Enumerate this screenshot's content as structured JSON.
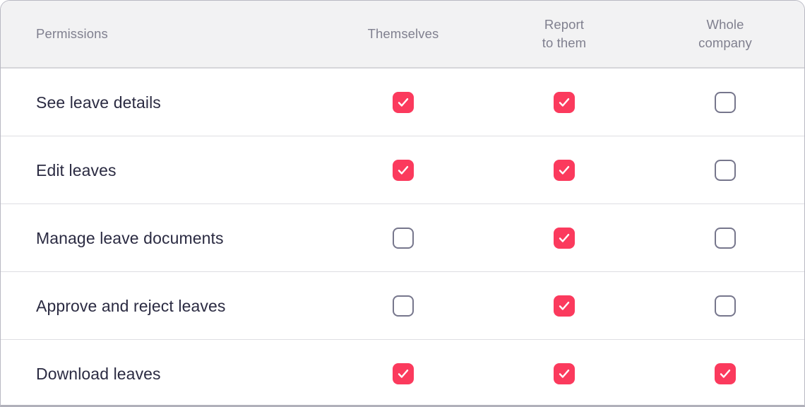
{
  "table": {
    "columns": [
      {
        "key": "permissions",
        "label": "Permissions"
      },
      {
        "key": "themselves",
        "label": "Themselves"
      },
      {
        "key": "report_to_them",
        "label": "Report\nto them"
      },
      {
        "key": "whole_company",
        "label": "Whole\ncompany"
      }
    ],
    "rows": [
      {
        "label": "See leave details",
        "themselves": true,
        "report_to_them": true,
        "whole_company": false
      },
      {
        "label": "Edit leaves",
        "themselves": true,
        "report_to_them": true,
        "whole_company": false
      },
      {
        "label": "Manage leave documents",
        "themselves": false,
        "report_to_them": true,
        "whole_company": false
      },
      {
        "label": "Approve and reject leaves",
        "themselves": false,
        "report_to_them": true,
        "whole_company": false
      },
      {
        "label": "Download leaves",
        "themselves": true,
        "report_to_them": true,
        "whole_company": true
      }
    ]
  },
  "icons": {
    "checked": "checkmark-icon",
    "unchecked": "empty-checkbox-icon"
  },
  "colors": {
    "accent": "#fb3a5d",
    "header_background": "#f2f2f3",
    "header_text": "#80808f",
    "row_text": "#2b2b42",
    "divider": "#dedee2",
    "checkbox_border": "#76768c",
    "card_border": "#b9b9c3"
  }
}
